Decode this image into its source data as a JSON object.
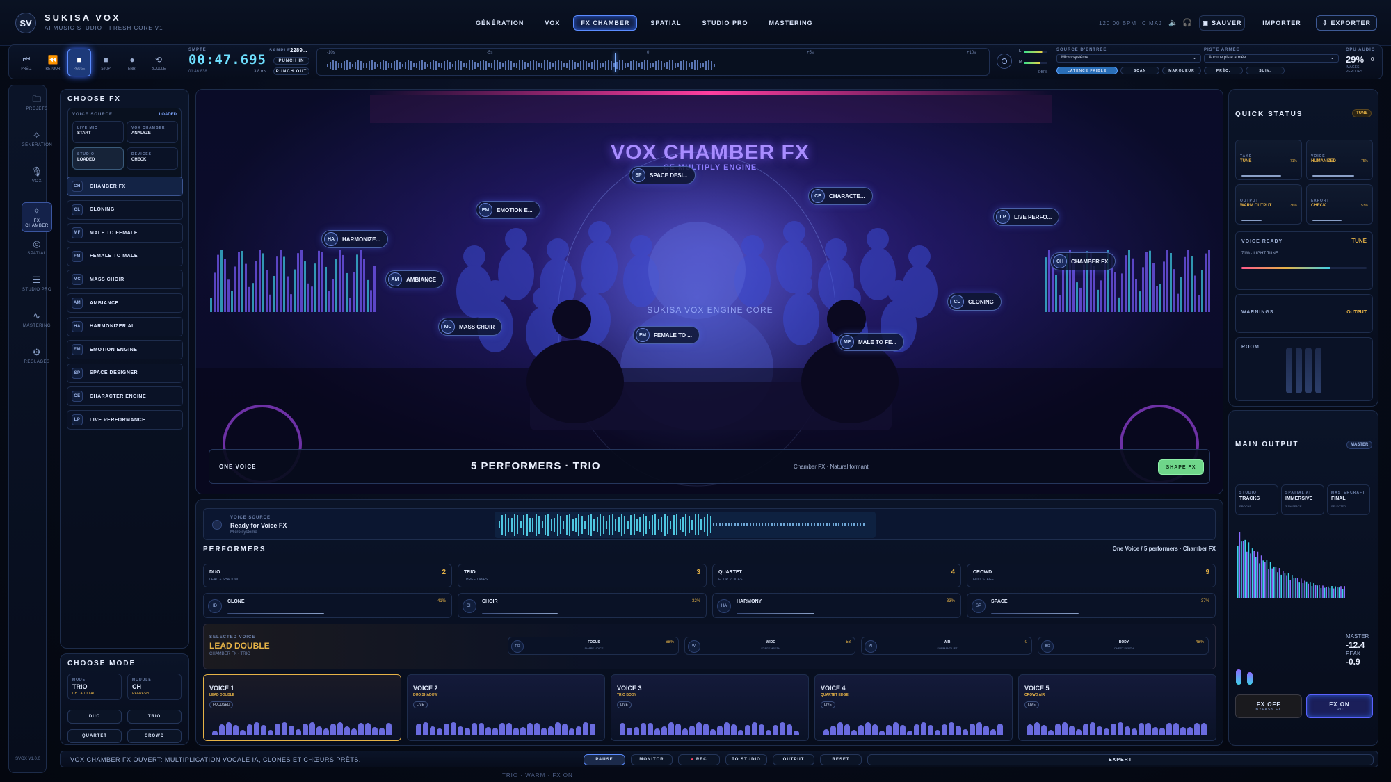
{
  "brand": {
    "logo": "SV",
    "name": "SUKISA VOX",
    "tagline": "AI MUSIC STUDIO · FRESH CORE V1",
    "version": "SVOX V1.0.0"
  },
  "top_tabs": [
    "GÉNÉRATION",
    "VOX",
    "FX CHAMBER",
    "SPATIAL",
    "STUDIO PRO",
    "MASTERING"
  ],
  "active_tab": "FX CHAMBER",
  "header": {
    "bpm": "120.00 BPM",
    "key": "C MAJ",
    "save": "SAUVER",
    "import": "IMPORTER",
    "export": "EXPORTER"
  },
  "transport": {
    "buttons": [
      {
        "icon": "skip-back-icon",
        "label": "PRÉC."
      },
      {
        "icon": "rewind-icon",
        "label": "RETOUR"
      },
      {
        "icon": "pause-icon",
        "label": "PAUSE"
      },
      {
        "icon": "stop-icon",
        "label": "STOP"
      },
      {
        "icon": "record-icon",
        "label": "ENR."
      },
      {
        "icon": "loop-icon",
        "label": "BOUCLE"
      }
    ],
    "smpte_label": "SMPTE",
    "time": "00:47.695",
    "subtime": "01:46:838",
    "sample_label": "SAMPLE",
    "sample_value": "2289...",
    "latency": "3.8 ms",
    "punch_in": "PUNCH IN",
    "punch_out": "PUNCH OUT",
    "timeline_marks": [
      "-10s",
      "-5s",
      "0",
      "+5s",
      "+10s"
    ],
    "meter_l": "L",
    "meter_r": "R",
    "dbfs": "DBFS",
    "source_label": "SOURCE D'ENTRÉE",
    "source_value": "Micro système",
    "track_label": "PISTE ARMÉE",
    "track_value": "Aucune piste armée",
    "actions": [
      "LATENCE FAIBLE",
      "SCAN",
      "MARQUEUR",
      "PRÉC.",
      "SUIV."
    ],
    "cpu_label": "CPU AUDIO",
    "cpu_value": "29%",
    "cpu_sub": "IMAGES PERDUES",
    "cpu_drop": "0"
  },
  "sidebar": [
    {
      "icon": "folder-icon",
      "label": "PROJETS"
    },
    {
      "icon": "sparkle-icon",
      "label": "GÉNÉRATION"
    },
    {
      "icon": "mic-icon",
      "label": "VOX"
    },
    {
      "icon": "sparkle-icon",
      "label": "FX CHAMBER"
    },
    {
      "icon": "spatial-icon",
      "label": "SPATIAL"
    },
    {
      "icon": "sliders-icon",
      "label": "STUDIO PRO"
    },
    {
      "icon": "wave-icon",
      "label": "MASTERING"
    },
    {
      "icon": "gear-icon",
      "label": "RÉGLAGES"
    }
  ],
  "choose_fx": {
    "title": "CHOOSE FX",
    "voice_source": "VOICE SOURCE",
    "voice_status": "LOADED",
    "source_cards": [
      {
        "label": "LIVE MIC",
        "value": "START"
      },
      {
        "label": "VOX CHAMBER",
        "value": "ANALYZE"
      },
      {
        "label": "STUDIO",
        "value": "LOADED"
      },
      {
        "label": "DEVICES",
        "value": "CHECK"
      }
    ],
    "items": [
      {
        "ab": "CH",
        "label": "CHAMBER FX"
      },
      {
        "ab": "CL",
        "label": "CLONING"
      },
      {
        "ab": "MF",
        "label": "MALE TO FEMALE"
      },
      {
        "ab": "FM",
        "label": "FEMALE TO MALE"
      },
      {
        "ab": "MC",
        "label": "MASS CHOIR"
      },
      {
        "ab": "AM",
        "label": "AMBIANCE"
      },
      {
        "ab": "HA",
        "label": "HARMONIZER AI"
      },
      {
        "ab": "EM",
        "label": "EMOTION ENGINE"
      },
      {
        "ab": "SP",
        "label": "SPACE DESIGNER"
      },
      {
        "ab": "CE",
        "label": "CHARACTER ENGINE"
      },
      {
        "ab": "LP",
        "label": "LIVE PERFORMANCE"
      }
    ]
  },
  "choose_mode": {
    "title": "CHOOSE MODE",
    "mode_label": "MODE",
    "mode_value": "TRIO",
    "mode_sub": "CH · AUTO AI",
    "module_label": "MODULE",
    "module_value": "CH",
    "module_sub": "REFRESH",
    "options": [
      "DUO",
      "TRIO",
      "QUARTET",
      "CROWD"
    ]
  },
  "stage": {
    "title": "VOX CHAMBER FX",
    "subtitle": "CE MULTIPLY ENGINE",
    "engine": "SUKISA VOX ENGINE CORE",
    "chips": [
      {
        "ab": "SP",
        "label": "SPACE DESI..."
      },
      {
        "ab": "EM",
        "label": "EMOTION E..."
      },
      {
        "ab": "CE",
        "label": "CHARACTE..."
      },
      {
        "ab": "LP",
        "label": "LIVE PERFO..."
      },
      {
        "ab": "HA",
        "label": "HARMONIZE..."
      },
      {
        "ab": "CH",
        "label": "CHAMBER FX"
      },
      {
        "ab": "AM",
        "label": "AMBIANCE"
      },
      {
        "ab": "CL",
        "label": "CLONING"
      },
      {
        "ab": "MC",
        "label": "MASS CHOIR"
      },
      {
        "ab": "FM",
        "label": "FEMALE TO ..."
      },
      {
        "ab": "MF",
        "label": "MALE TO FE..."
      }
    ],
    "bar_left": "ONE VOICE",
    "bar_center": "5 PERFORMERS · TRIO",
    "bar_right": "Chamber FX · Natural formant",
    "shape_button": "SHAPE FX"
  },
  "voice_source_strip": {
    "label": "VOICE SOURCE",
    "status": "Ready for Voice FX",
    "sub": "Micro système"
  },
  "performers": {
    "title": "PERFORMERS",
    "summary": "One Voice / 5 performers · Chamber FX",
    "counts": [
      {
        "name": "DUO",
        "sub": "LEAD + SHADOW",
        "n": "2"
      },
      {
        "name": "TRIO",
        "sub": "THREE TAKES",
        "n": "3"
      },
      {
        "name": "QUARTET",
        "sub": "FOUR VOICES",
        "n": "4"
      },
      {
        "name": "CROWD",
        "sub": "FULL STAGE",
        "n": "9"
      }
    ],
    "fx": [
      {
        "ab": "ID",
        "name": "CLONE",
        "pct": "41%"
      },
      {
        "ab": "CH",
        "name": "CHOIR",
        "pct": "32%"
      },
      {
        "ab": "HA",
        "name": "HARMONY",
        "pct": "33%"
      },
      {
        "ab": "SP",
        "name": "SPACE",
        "pct": "37%"
      }
    ]
  },
  "selected_voice": {
    "label": "SELECTED VOICE",
    "name": "LEAD DOUBLE",
    "sub": "CHAMBER FX · TRIO",
    "params": [
      {
        "ab": "FO",
        "name": "FOCUS",
        "sub": "SHAPE VOICE",
        "val": "68%"
      },
      {
        "ab": "WI",
        "name": "WIDE",
        "sub": "STAGE WIDTH",
        "val": "53"
      },
      {
        "ab": "AI",
        "name": "AIR",
        "sub": "FORMANT LIFT",
        "val": "0"
      },
      {
        "ab": "BO",
        "name": "BODY",
        "sub": "CHEST DEPTH",
        "val": "48%"
      }
    ]
  },
  "voices": [
    {
      "name": "VOICE 1",
      "sub": "LEAD DOUBLE",
      "tag": "FOCUSED"
    },
    {
      "name": "VOICE 2",
      "sub": "DUO SHADOW",
      "tag": "LIVE"
    },
    {
      "name": "VOICE 3",
      "sub": "TRIO BODY",
      "tag": "LIVE"
    },
    {
      "name": "VOICE 4",
      "sub": "QUARTET EDGE",
      "tag": "LIVE"
    },
    {
      "name": "VOICE 5",
      "sub": "CROWD AIR",
      "tag": "LIVE"
    }
  ],
  "quick_status": {
    "title": "QUICK STATUS",
    "badge": "TUNE",
    "cards": [
      {
        "label": "TAKE",
        "value": "TUNE",
        "pct": "71%"
      },
      {
        "label": "VOICE",
        "value": "HUMANIZED",
        "pct": "75%"
      },
      {
        "label": "OUTPUT",
        "value": "WARM OUTPUT",
        "pct": "36%"
      },
      {
        "label": "EXPORT",
        "value": "CHECK",
        "pct": "53%"
      }
    ],
    "ready_label": "VOICE READY",
    "ready_value": "TUNE",
    "ready_sub": "71% · LIGHT TUNE",
    "ready_level": 0.71,
    "warnings_label": "WARNINGS",
    "warnings_value": "OUTPUT",
    "room_label": "ROOM"
  },
  "main_output": {
    "title": "MAIN OUTPUT",
    "badge": "MASTER",
    "cards": [
      {
        "label": "STUDIO",
        "value": "TRACKS",
        "sub": "PROCHE"
      },
      {
        "label": "SPATIAL AI",
        "value": "IMMERSIVE",
        "sub": "3.1% SPACE"
      },
      {
        "label": "MASTERCRAFT",
        "value": "FINAL",
        "sub": "SELECTED"
      }
    ],
    "master_label": "MASTER",
    "master_value": "-12.4",
    "peak_label": "PEAK",
    "peak_value": "-0.9",
    "fx_off": "FX OFF",
    "fx_off_sub": "BYPASS FX",
    "fx_on": "FX ON",
    "fx_on_sub": "TRIO"
  },
  "status_bar": {
    "message": "VOX CHAMBER FX OUVERT: MULTIPLICATION VOCALE IA, CLONES ET CHŒURS PRÊTS.",
    "buttons": [
      "PAUSE",
      "MONITOR",
      "REC",
      "TO STUDIO",
      "OUTPUT",
      "RESET"
    ],
    "expert": "EXPERT",
    "footer": "TRIO · WARM · FX ON"
  },
  "colors": {
    "accent": "#5b8cff",
    "gold": "#e6b347",
    "green": "#7ee08a",
    "cyan": "#3fd0e8",
    "violet": "#8a6bff",
    "pink": "#ff3fa0"
  }
}
